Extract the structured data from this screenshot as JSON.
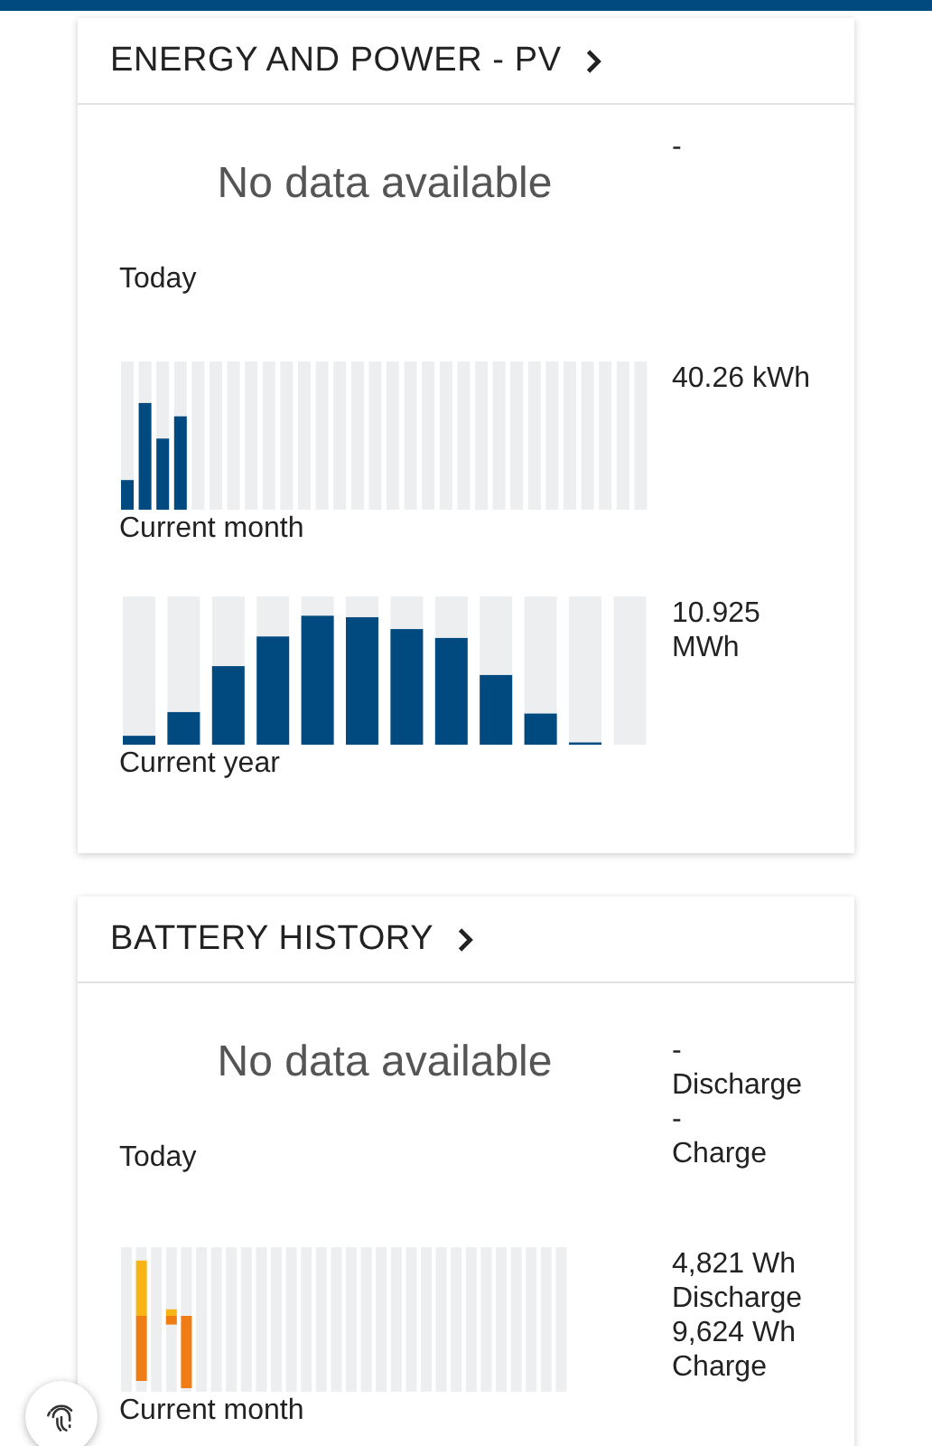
{
  "cards": [
    {
      "kind": "pv",
      "title": "ENERGY AND POWER - PV",
      "message": "No data available",
      "today": {
        "label": "Today",
        "values": [
          {
            "text": "-"
          }
        ]
      },
      "month": {
        "label": "Current month",
        "values": [
          {
            "text": "40.26 kWh"
          }
        ]
      },
      "year": {
        "label": "Current year",
        "values": [
          {
            "text": "10.925 MWh"
          }
        ]
      }
    },
    {
      "kind": "battery",
      "title": "BATTERY HISTORY",
      "message": "No data available",
      "today": {
        "label": "Today",
        "values": [
          {
            "text": "-"
          },
          {
            "text": "Discharge"
          },
          {
            "text": "-"
          },
          {
            "text": "Charge"
          }
        ]
      },
      "month": {
        "label": "Current month",
        "values": [
          {
            "text": "4,821 Wh"
          },
          {
            "text": "Discharge"
          },
          {
            "text": "9,624 Wh"
          },
          {
            "text": "Charge"
          }
        ]
      }
    }
  ]
}
